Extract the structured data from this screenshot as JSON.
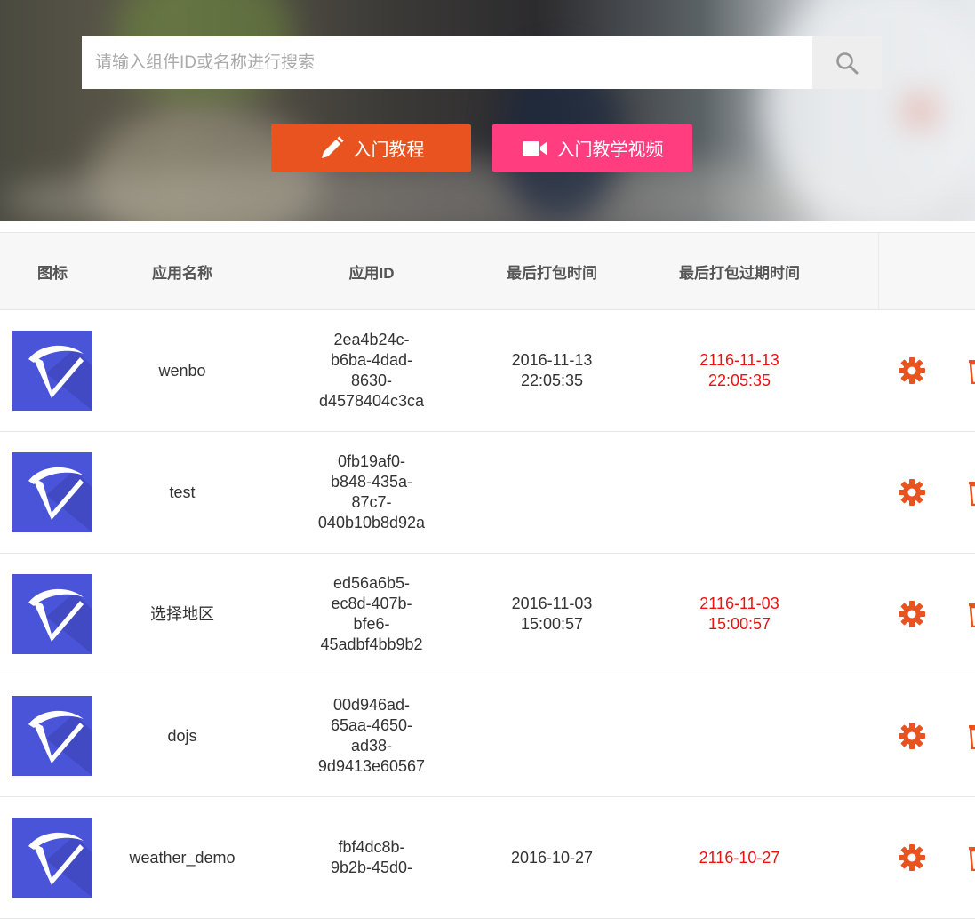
{
  "search": {
    "placeholder": "请输入组件ID或名称进行搜索"
  },
  "buttons": {
    "tutorial": "入门教程",
    "video": "入门教学视频"
  },
  "table": {
    "headers": [
      "图标",
      "应用名称",
      "应用ID",
      "最后打包时间",
      "最后打包过期时间"
    ],
    "rows": [
      {
        "name": "wenbo",
        "id_lines": [
          "2ea4b24c-",
          "b6ba-4dad-",
          "8630-",
          "d4578404c3ca"
        ],
        "pack_date": "2016-11-13",
        "pack_time": "22:05:35",
        "exp_date": "2116-11-13",
        "exp_time": "22:05:35"
      },
      {
        "name": "test",
        "id_lines": [
          "0fb19af0-",
          "b848-435a-",
          "87c7-",
          "040b10b8d92a"
        ],
        "pack_date": "",
        "pack_time": "",
        "exp_date": "",
        "exp_time": ""
      },
      {
        "name": "选择地区",
        "id_lines": [
          "ed56a6b5-",
          "ec8d-407b-",
          "bfe6-",
          "45adbf4bb9b2"
        ],
        "pack_date": "2016-11-03",
        "pack_time": "15:00:57",
        "exp_date": "2116-11-03",
        "exp_time": "15:00:57"
      },
      {
        "name": "dojs",
        "id_lines": [
          "00d946ad-",
          "65aa-4650-",
          "ad38-",
          "9d9413e60567"
        ],
        "pack_date": "",
        "pack_time": "",
        "exp_date": "",
        "exp_time": ""
      },
      {
        "name": "weather_demo",
        "id_lines": [
          "fbf4dc8b-",
          "9b2b-45d0-",
          "",
          ""
        ],
        "pack_date": "2016-10-27",
        "pack_time": "",
        "exp_date": "2116-10-27",
        "exp_time": ""
      }
    ]
  },
  "icons": {
    "search": "search-icon",
    "pencil": "pencil-icon",
    "video": "video-camera-icon",
    "settings": "gear-icon",
    "delete": "trash-icon",
    "app": "app-logo-icon"
  },
  "colors": {
    "tutorial_button": "#e8531f",
    "video_button": "#ff3d7f",
    "expiry_text": "#ee1111",
    "action_icon": "#e8531f",
    "app_icon_bg": "#4a54d8"
  }
}
